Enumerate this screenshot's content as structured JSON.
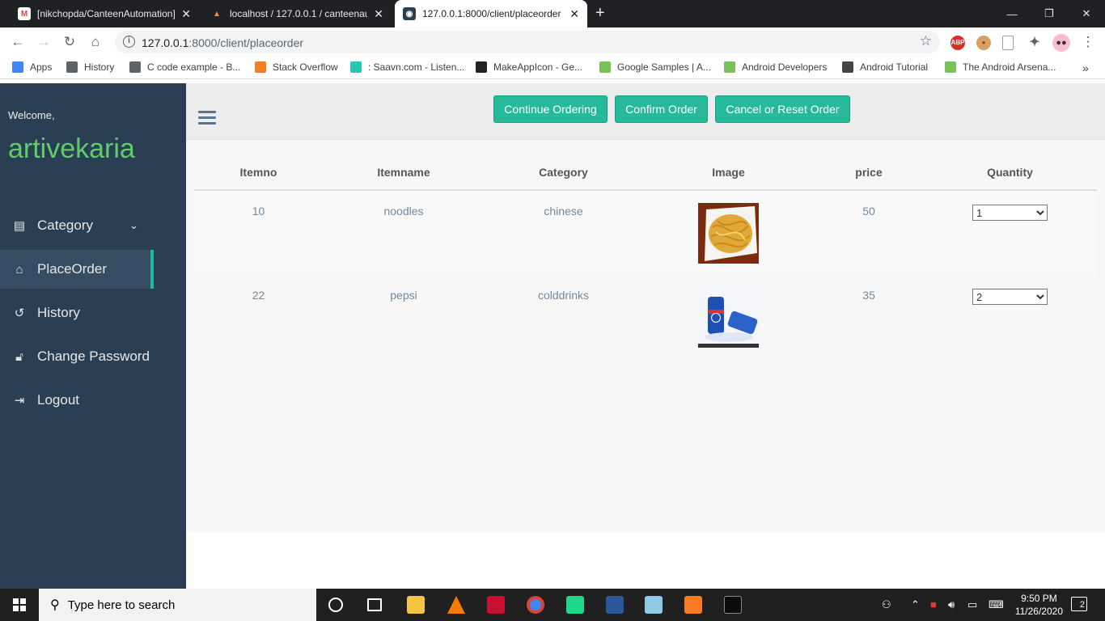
{
  "browser": {
    "tabs": [
      {
        "title": "[nikchopda/CanteenAutomation]",
        "active": false
      },
      {
        "title": "localhost / 127.0.0.1 / canteenaut",
        "active": false
      },
      {
        "title": "127.0.0.1:8000/client/placeorder",
        "active": true
      }
    ],
    "url_host": "127.0.0.1",
    "url_rest": ":8000/client/placeorder",
    "bookmarks": [
      {
        "label": "Apps",
        "color": "#4285f4"
      },
      {
        "label": "History",
        "color": "#5f6368"
      },
      {
        "label": "C code example - B...",
        "color": "#5f6368"
      },
      {
        "label": "Stack Overflow",
        "color": "#f48024"
      },
      {
        "label": ": Saavn.com - Listen...",
        "color": "#2bc5b4"
      },
      {
        "label": "MakeAppIcon - Ge...",
        "color": "#222222"
      },
      {
        "label": "Google Samples | A...",
        "color": "#78c257"
      },
      {
        "label": "Android Developers",
        "color": "#78c257"
      },
      {
        "label": "Android Tutorial",
        "color": "#444444"
      },
      {
        "label": "The Android Arsena...",
        "color": "#78c257"
      }
    ],
    "more_bookmarks": "»"
  },
  "sidebar": {
    "welcome": "Welcome,",
    "username": "artivekaria",
    "items": [
      {
        "label": "Category",
        "icon": "category-icon"
      },
      {
        "label": "PlaceOrder",
        "icon": "home-icon"
      },
      {
        "label": "History",
        "icon": "history-icon"
      },
      {
        "label": "Change Password",
        "icon": "unlock-icon"
      },
      {
        "label": "Logout",
        "icon": "logout-icon"
      }
    ]
  },
  "actions": {
    "continue": "Continue Ordering",
    "confirm": "Confirm Order",
    "cancel": "Cancel or Reset Order"
  },
  "table": {
    "headers": [
      "Itemno",
      "Itemname",
      "Category",
      "Image",
      "price",
      "Quantity"
    ],
    "rows": [
      {
        "itemno": "10",
        "itemname": "noodles",
        "category": "chinese",
        "price": "50",
        "quantity": "1"
      },
      {
        "itemno": "22",
        "itemname": "pepsi",
        "category": "colddrinks",
        "price": "35",
        "quantity": "2"
      }
    ]
  },
  "taskbar": {
    "search_placeholder": "Type here to search",
    "time": "9:50 PM",
    "date": "11/26/2020",
    "notifications": "2"
  },
  "colors": {
    "sidebar": "#2a3f54",
    "accent": "#26b99a",
    "username": "#5fce6a"
  }
}
